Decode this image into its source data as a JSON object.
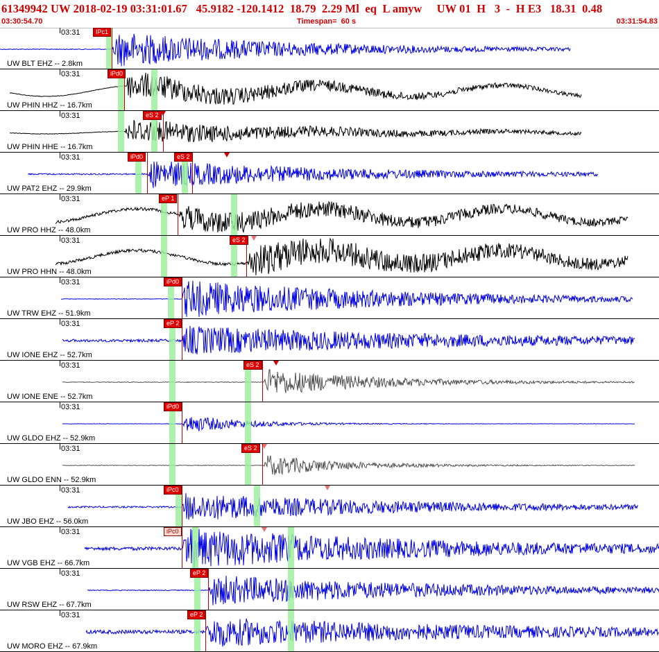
{
  "header": {
    "title": "61349942 UW 2018-02-19 03:31:01.67   45.9182 -120.1412  18.79  2.29 Ml  eq  L amyw     UW 01  H   3  -  H E3   18.31  0.48",
    "start_time": "03:30:54.70",
    "timespan": "Timespan=  60 s",
    "end_time": "03:31:54.83"
  },
  "colors": {
    "blue_trace": "#0000e0",
    "black_trace": "#000000",
    "gray_trace": "#505050",
    "pick_red": "#e00000",
    "window_green": "#9ef09e"
  },
  "traces": [
    {
      "time": "03:31",
      "label": "UW BLT EHZ -- 2.8km",
      "phases": [
        "IPc1"
      ],
      "color": "blue",
      "amp": "high"
    },
    {
      "time": "03:31",
      "label": "UW PHIN HHZ -- 16.7km",
      "phases": [
        "iPd0"
      ],
      "color": "black",
      "amp": "mid"
    },
    {
      "time": "03:31",
      "label": "UW PHIN HHE -- 16.7km",
      "phases": [
        "eS 2"
      ],
      "color": "black",
      "amp": "mid"
    },
    {
      "time": "03:31",
      "label": "UW PAT2 EHZ -- 29.9km",
      "phases": [
        "iPd0",
        "eS 2"
      ],
      "color": "blue",
      "amp": "mid"
    },
    {
      "time": "03:31",
      "label": "UW PRO HHZ -- 48.0km",
      "phases": [
        "eP 1"
      ],
      "color": "black",
      "amp": "mid"
    },
    {
      "time": "03:31",
      "label": "UW PRO HHN -- 48.0km",
      "phases": [
        "eS 2"
      ],
      "color": "black",
      "amp": "mid"
    },
    {
      "time": "03:31",
      "label": "UW TRW EHZ -- 51.9km",
      "phases": [
        "iPd0"
      ],
      "color": "blue",
      "amp": "high"
    },
    {
      "time": "03:31",
      "label": "UW IONE EHZ -- 52.7km",
      "phases": [
        "eP 2"
      ],
      "color": "blue",
      "amp": "mid"
    },
    {
      "time": "03:31",
      "label": "UW IONE ENE -- 52.7km",
      "phases": [
        "eS 2"
      ],
      "color": "gray",
      "amp": "mid"
    },
    {
      "time": "03:31",
      "label": "UW GLDO EHZ -- 52.9km",
      "phases": [
        "iPd0"
      ],
      "color": "blue",
      "amp": "low"
    },
    {
      "time": "03:31",
      "label": "UW GLDO ENN -- 52.9km",
      "phases": [
        "eS 2"
      ],
      "color": "gray",
      "amp": "low"
    },
    {
      "time": "03:31",
      "label": "UW JBO EHZ -- 56.0km",
      "phases": [
        "iPc0"
      ],
      "color": "blue",
      "amp": "mid"
    },
    {
      "time": "03:31",
      "label": "UW VGB EHZ -- 66.7km",
      "phases": [
        "iPc0"
      ],
      "color": "blue",
      "amp": "high"
    },
    {
      "time": "03:31",
      "label": "UW RSW EHZ -- 67.7km",
      "phases": [
        "eP 2"
      ],
      "color": "blue",
      "amp": "mid"
    },
    {
      "time": "03:31",
      "label": "UW MORO EHZ -- 67.9km",
      "phases": [
        "eP 2"
      ],
      "color": "blue",
      "amp": "mid"
    }
  ]
}
